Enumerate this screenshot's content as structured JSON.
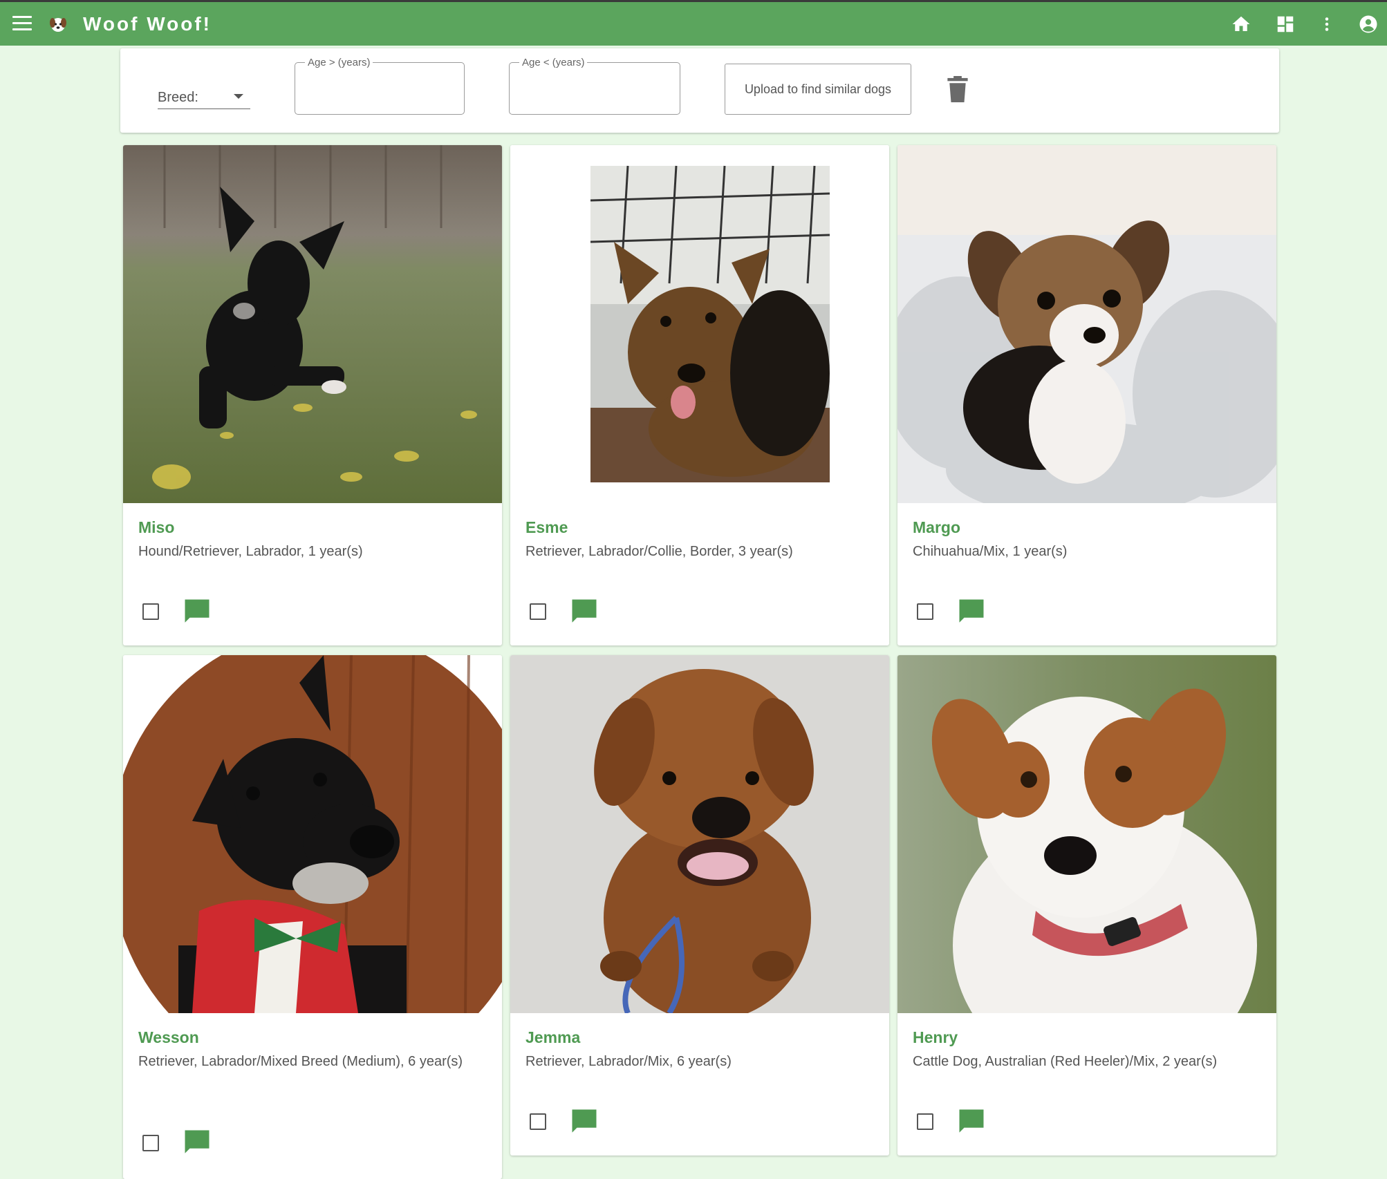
{
  "app": {
    "title": "Woof Woof!",
    "icons": [
      "menu-icon",
      "dog-logo-icon",
      "home-icon",
      "dashboard-icon",
      "more-vert-icon",
      "account-icon"
    ],
    "accent_color": "#5ba55d"
  },
  "filters": {
    "breed_label": "Breed:",
    "age_min_label": "Age > (years)",
    "age_min_value": "",
    "age_max_label": "Age < (years)",
    "age_max_value": "",
    "upload_label": "Upload to find similar dogs",
    "clear_icon": "trash-icon"
  },
  "dogs": [
    {
      "name": "Miso",
      "description": "Hound/Retriever, Labrador, 1 year(s)",
      "checked": false
    },
    {
      "name": "Esme",
      "description": "Retriever, Labrador/Collie, Border, 3 year(s)",
      "checked": false
    },
    {
      "name": "Margo",
      "description": "Chihuahua/Mix, 1 year(s)",
      "checked": false
    },
    {
      "name": "Wesson",
      "description": "Retriever, Labrador/Mixed Breed (Medium), 6 year(s)",
      "checked": false
    },
    {
      "name": "Jemma",
      "description": "Retriever, Labrador/Mix, 6 year(s)",
      "checked": false
    },
    {
      "name": "Henry",
      "description": "Cattle Dog, Australian (Red Heeler)/Mix, 2 year(s)",
      "checked": false
    }
  ]
}
